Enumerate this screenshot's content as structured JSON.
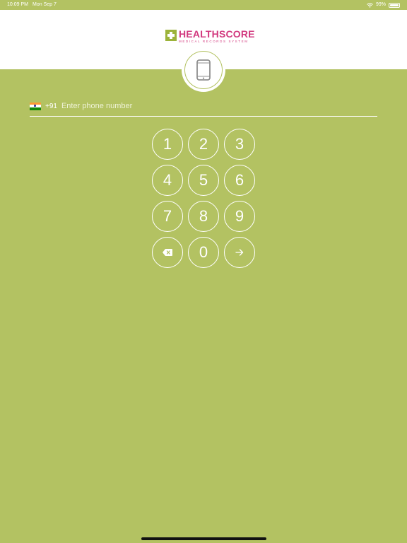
{
  "status_bar": {
    "time": "10:09 PM",
    "date": "Mon Sep 7",
    "battery": "99%"
  },
  "logo": {
    "word1": "HEALTH",
    "word2": "SCORE",
    "subtitle": "MEDICAL RECORDS SYSTEM"
  },
  "phone": {
    "country_code": "+91",
    "placeholder": "Enter phone number",
    "value": ""
  },
  "keypad": {
    "keys": [
      "1",
      "2",
      "3",
      "4",
      "5",
      "6",
      "7",
      "8",
      "9",
      "0"
    ]
  },
  "icons": {
    "phone": "mobile-phone-icon",
    "flag": "india-flag-icon",
    "backspace": "backspace-icon",
    "submit": "arrow-right-icon",
    "wifi": "wifi-icon",
    "battery": "battery-icon"
  },
  "colors": {
    "background": "#b3c262",
    "header": "#ffffff",
    "brand_pink": "#d23a7f",
    "brand_green": "#9cb33a",
    "key_border": "#ffffff"
  }
}
